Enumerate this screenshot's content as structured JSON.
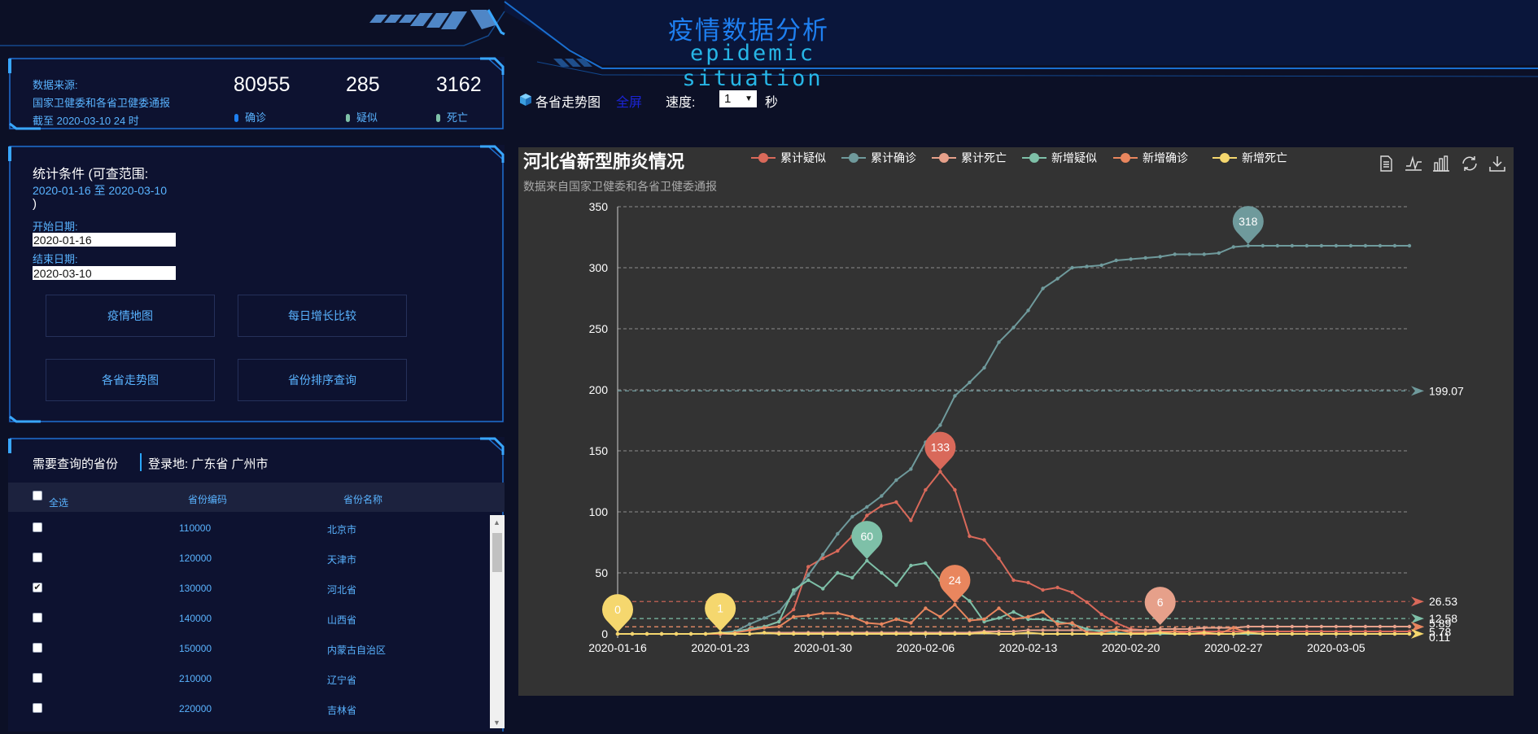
{
  "header": {
    "title": "疫情数据分析",
    "subtitle": "epidemic situation"
  },
  "stats": {
    "source_label": "数据来源:",
    "source_name": "国家卫健委和各省卫健委通报",
    "as_of": "截至 2020-03-10 24 时",
    "confirmed": {
      "value": "80955",
      "label": "确诊",
      "color": "#1e7ff0"
    },
    "suspected": {
      "value": "285",
      "label": "疑似",
      "color": "#7ec0a8"
    },
    "deaths": {
      "value": "3162",
      "label": "死亡",
      "color": "#7ec0a8"
    }
  },
  "conditions": {
    "title": "统计条件 (可查范围:",
    "range": "2020-01-16 至 2020-03-10",
    "close_paren": ")",
    "start_label": "开始日期:",
    "start_value": "2020-01-16",
    "end_label": "结束日期:",
    "end_value": "2020-03-10",
    "buttons": [
      "疫情地图",
      "每日增长比较",
      "各省走势图",
      "省份排序查询"
    ]
  },
  "provinces": {
    "header_label": "需要查询的省份",
    "login_label": "登录地: 广东省 广州市",
    "columns": {
      "select_all": "全选",
      "code": "省份编码",
      "name": "省份名称"
    },
    "rows": [
      {
        "code": "110000",
        "name": "北京市",
        "checked": false
      },
      {
        "code": "120000",
        "name": "天津市",
        "checked": false
      },
      {
        "code": "130000",
        "name": "河北省",
        "checked": true
      },
      {
        "code": "140000",
        "name": "山西省",
        "checked": false
      },
      {
        "code": "150000",
        "name": "内蒙古自治区",
        "checked": false
      },
      {
        "code": "210000",
        "name": "辽宁省",
        "checked": false
      },
      {
        "code": "220000",
        "name": "吉林省",
        "checked": false
      }
    ]
  },
  "toolbar": {
    "trend_label": "各省走势图",
    "fullscreen_label": "全屏",
    "speed_label": "速度:",
    "speed_value": "1",
    "speed_unit": "秒"
  },
  "chart_toolbox": [
    "data-view-icon",
    "line-chart-icon",
    "bar-chart-icon",
    "restore-icon",
    "save-image-icon"
  ],
  "chart_data": {
    "type": "line",
    "title": "河北省新型肺炎情况",
    "subtitle": "数据来自国家卫健委和各省卫健委通报",
    "x_ticks": [
      "2020-01-16",
      "2020-01-23",
      "2020-01-30",
      "2020-02-06",
      "2020-02-13",
      "2020-02-20",
      "2020-02-27",
      "2020-03-05"
    ],
    "x_start": "2020-01-16",
    "x_end": "2020-03-10",
    "ylim": [
      0,
      350
    ],
    "y_ticks": [
      0,
      50,
      100,
      150,
      200,
      250,
      300,
      350
    ],
    "grid": true,
    "series": [
      {
        "name": "累计疑似",
        "color": "#d9695a",
        "legend": true,
        "values": [
          0,
          0,
          0,
          0,
          0,
          0,
          0,
          0,
          2,
          4,
          6,
          10,
          20,
          55,
          62,
          68,
          80,
          97,
          105,
          108,
          93,
          118,
          133,
          118,
          80,
          77,
          62,
          44,
          42,
          36,
          38,
          34,
          26,
          16,
          9,
          4,
          3,
          2,
          2,
          2,
          2,
          2,
          2,
          2,
          2,
          2,
          2,
          2,
          2,
          2,
          2,
          2,
          2,
          2,
          2
        ],
        "avg": 26.53,
        "max_label": {
          "day": 22,
          "value": 133
        }
      },
      {
        "name": "累计确诊",
        "color": "#6f9a9c",
        "legend": true,
        "values": [
          0,
          0,
          0,
          0,
          0,
          0,
          0,
          1,
          2,
          8,
          13,
          18,
          33,
          48,
          65,
          82,
          96,
          104,
          113,
          126,
          135,
          157,
          171,
          195,
          206,
          218,
          239,
          251,
          265,
          283,
          291,
          300,
          301,
          302,
          306,
          307,
          308,
          309,
          311,
          311,
          311,
          312,
          317,
          318,
          318,
          318,
          318,
          318,
          318,
          318,
          318,
          318,
          318,
          318,
          318
        ],
        "avg": 199.07,
        "max_label": {
          "day": 43,
          "value": 318
        }
      },
      {
        "name": "累计死亡",
        "color": "#e6a08a",
        "legend": true,
        "values": [
          0,
          0,
          0,
          0,
          0,
          0,
          0,
          0,
          0,
          0,
          1,
          1,
          1,
          1,
          1,
          1,
          1,
          1,
          1,
          1,
          1,
          1,
          1,
          1,
          1,
          2,
          2,
          2,
          3,
          3,
          3,
          3,
          3,
          3,
          3,
          3,
          3,
          4,
          4,
          4,
          5,
          5,
          5,
          6,
          6,
          6,
          6,
          6,
          6,
          6,
          6,
          6,
          6,
          6,
          6
        ],
        "avg": 5.78,
        "max_label": {
          "day": 37,
          "value": 6
        }
      },
      {
        "name": "新增疑似",
        "color": "#7ec0a8",
        "legend": true,
        "values": [
          0,
          0,
          0,
          0,
          0,
          0,
          0,
          0,
          2,
          4,
          6,
          10,
          36,
          44,
          37,
          50,
          46,
          60,
          50,
          40,
          56,
          58,
          44,
          36,
          27,
          10,
          13,
          18,
          12,
          12,
          10,
          8,
          4,
          2,
          1,
          0,
          0,
          0,
          0,
          0,
          0,
          0,
          0,
          0,
          0,
          0,
          0,
          0,
          0,
          0,
          0,
          0,
          0,
          0,
          0
        ],
        "avg": 12.58,
        "max_label": {
          "day": 17,
          "value": 60
        }
      },
      {
        "name": "新增确诊",
        "color": "#e9865e",
        "legend": true,
        "values": [
          0,
          0,
          0,
          0,
          0,
          0,
          0,
          0,
          1,
          3,
          5,
          6,
          14,
          15,
          17,
          17,
          14,
          9,
          8,
          12,
          9,
          21,
          14,
          24,
          11,
          12,
          21,
          12,
          14,
          18,
          8,
          9,
          1,
          1,
          4,
          1,
          1,
          1,
          2,
          0,
          0,
          0,
          5,
          1,
          0,
          0,
          0,
          0,
          0,
          0,
          0,
          0,
          0,
          0,
          0
        ],
        "avg": 5.89,
        "max_label": {
          "day": 23,
          "value": 24
        }
      },
      {
        "name": "新增死亡",
        "color": "#f5d76e",
        "legend": true,
        "values": [
          0,
          0,
          0,
          0,
          0,
          0,
          0,
          1,
          0,
          0,
          1,
          0,
          0,
          0,
          0,
          0,
          0,
          0,
          0,
          0,
          0,
          0,
          0,
          0,
          0,
          1,
          0,
          0,
          1,
          0,
          0,
          0,
          0,
          0,
          0,
          0,
          0,
          1,
          0,
          0,
          1,
          0,
          0,
          1,
          0,
          0,
          0,
          0,
          0,
          0,
          0,
          0,
          0,
          0,
          0
        ],
        "avg": 0.11,
        "min_labels": [
          {
            "day": 0,
            "value": 0
          },
          {
            "day": 7,
            "value": 1
          }
        ]
      }
    ],
    "avg_labels": [
      "199.07",
      "26.53",
      "12.58",
      "5.78",
      "0.11"
    ]
  }
}
